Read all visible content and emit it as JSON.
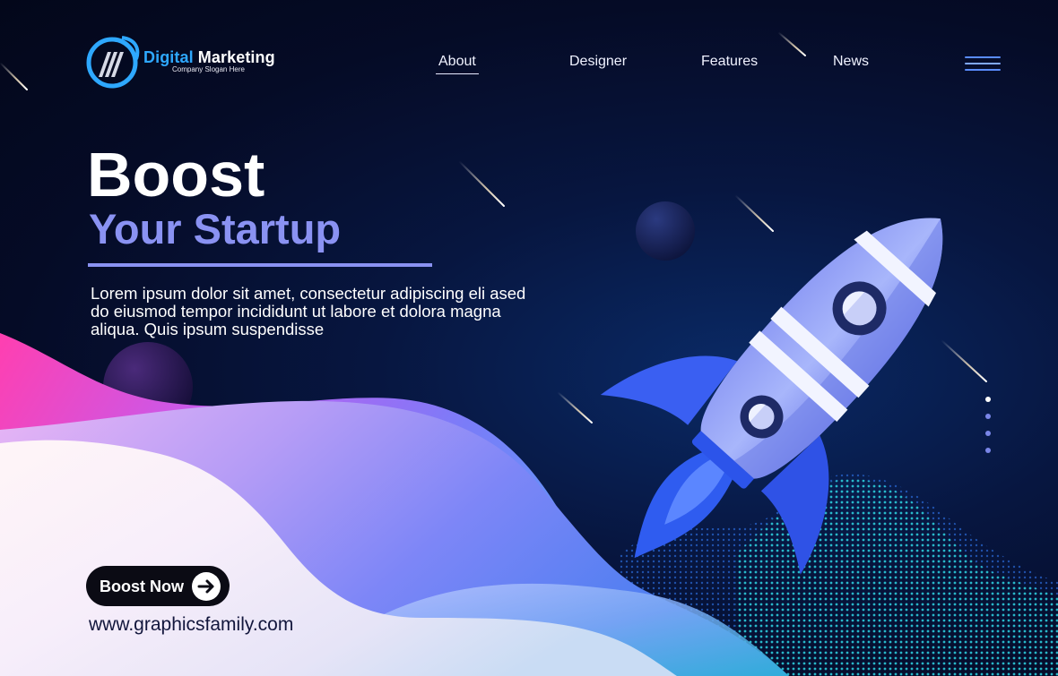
{
  "brand": {
    "name_accent": "Digital",
    "name_rest": " Marketing",
    "slogan": "Company Slogan Here"
  },
  "nav": {
    "items": [
      {
        "label": "About",
        "active": true
      },
      {
        "label": "Designer"
      },
      {
        "label": "Features"
      },
      {
        "label": "News"
      }
    ],
    "menu_icon": "hamburger-menu-icon"
  },
  "hero": {
    "title": "Boost",
    "subtitle": "Your Startup",
    "body": "Lorem ipsum dolor sit amet, consectetur adipiscing eli ased do eiusmod tempor incididunt ut labore et dolora magna aliqua. Quis ipsum suspendisse"
  },
  "cta": {
    "label": "Boost Now",
    "icon": "arrow-right-icon"
  },
  "footer": {
    "url": "www.graphicsfamily.com"
  },
  "pager": {
    "count": 4,
    "active_index": 0
  },
  "colors": {
    "accent_blue": "#2ea8ff",
    "subtitle_purple": "#8a92f2",
    "background_navy": "#050b26"
  }
}
